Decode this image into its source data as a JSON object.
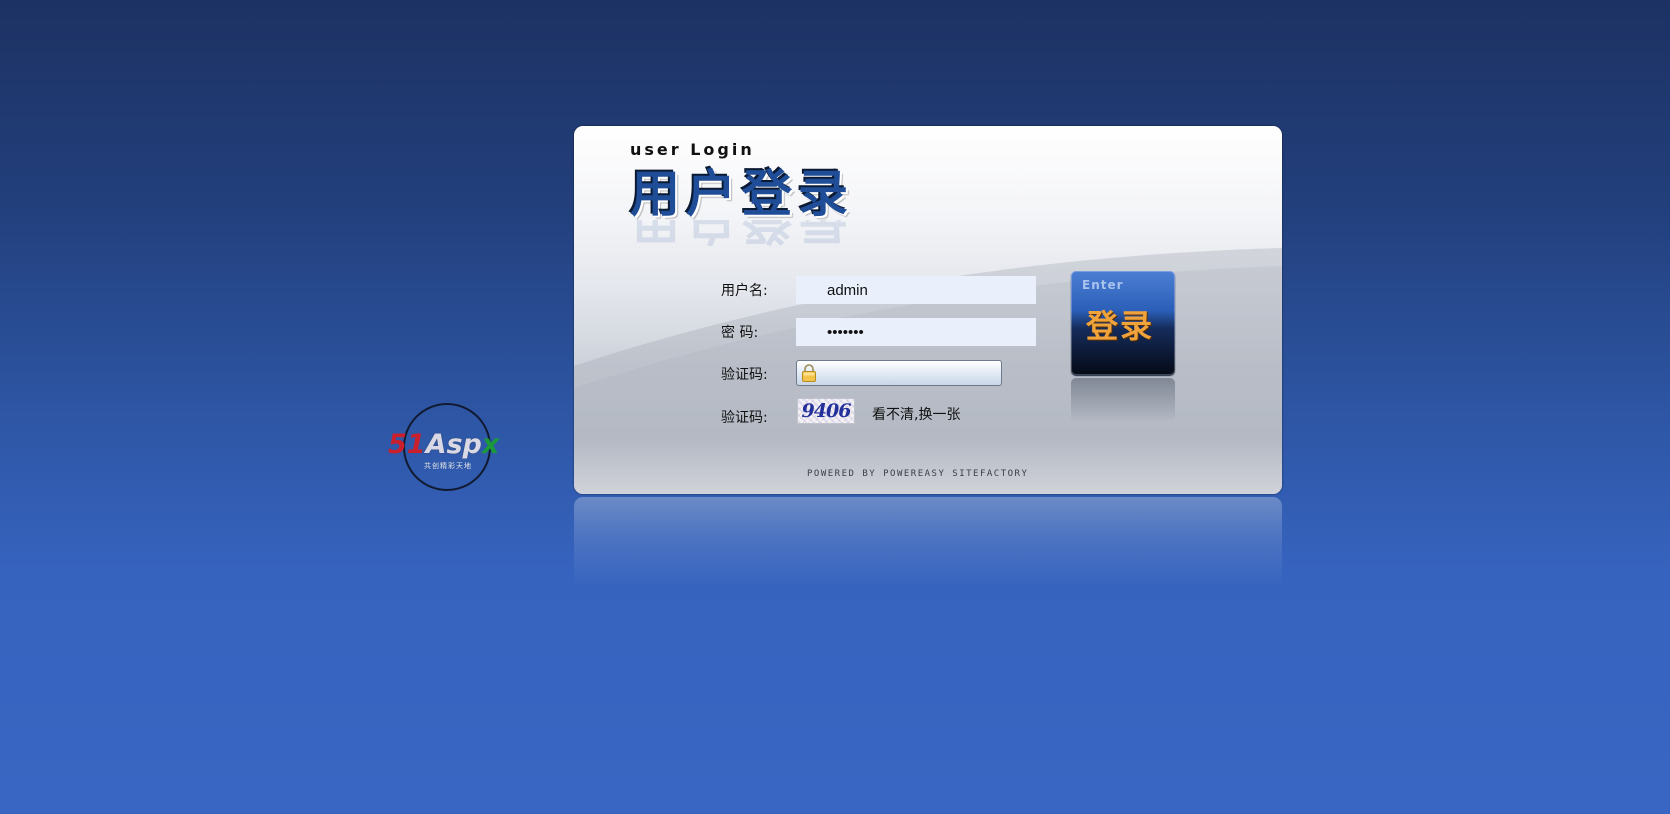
{
  "brand": {
    "logo_number": "51",
    "logo_name": "Asp",
    "logo_x": "x",
    "logo_tagline": "共创精彩天地"
  },
  "login": {
    "subtitle": "user Login",
    "title": "用户登录",
    "fields": {
      "username_label": "用户名:",
      "username_value": "admin",
      "password_label": "密 码:",
      "password_value": "1234567",
      "captcha_label": "验证码:",
      "captcha_value": "",
      "captcha_image_label": "验证码:",
      "captcha_code": "9406",
      "refresh_link": "看不清,换一张"
    },
    "enter_button": {
      "label_en": "Enter",
      "label_cn": "登录"
    },
    "footer": "POWERED BY POWEREASY SITEFACTORY"
  },
  "colors": {
    "page_top": "#1d3263",
    "page_bottom": "#3866c2",
    "title_blue": "#1f4d97",
    "input_bg": "#e9f0fc",
    "enter_orange": "#f0a33b"
  },
  "icons": {
    "captcha_field": "lock-icon"
  }
}
